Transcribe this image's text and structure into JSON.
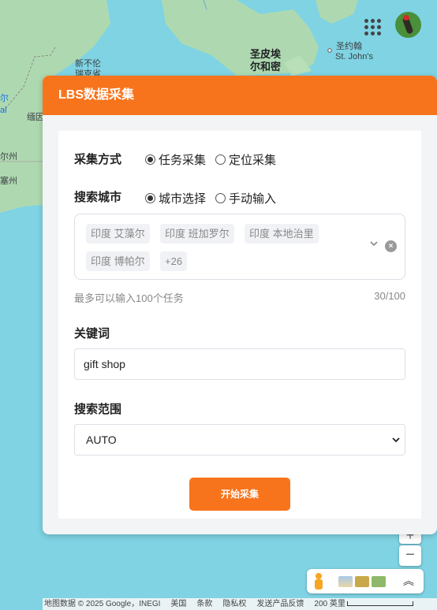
{
  "map": {
    "labels": {
      "saint_pierre": "圣皮埃",
      "miquelon": "尔和密",
      "st_johns_cn": "圣约翰",
      "st_johns_en": "St. John's",
      "newfoundland_1": "新不伦",
      "newfoundland_2": "瑞克省",
      "maine_frag": "缅因",
      "state_frag_1": "尔州",
      "state_frag_2": "塞州",
      "blue_frag_1": "尔",
      "blue_frag_2": "al"
    },
    "attribution": {
      "data": "地图数据 © 2025 Google，INEGI",
      "country": "美国",
      "terms": "条款",
      "privacy": "隐私权",
      "feedback": "发送产品反馈",
      "scale": "200 英里"
    },
    "colors": {
      "water": "#7fd3e3",
      "land": "#aed9b0"
    }
  },
  "panel": {
    "title": "LBS数据采集",
    "method": {
      "label": "采集方式",
      "options": [
        "任务采集",
        "定位采集"
      ],
      "selected": "任务采集"
    },
    "city": {
      "label": "搜索城市",
      "options": [
        "城市选择",
        "手动输入"
      ],
      "selected": "城市选择",
      "tags": [
        "印度 艾藻尔",
        "印度 班加罗尔",
        "印度 本地治里",
        "印度 博帕尔",
        "+26"
      ],
      "hint": "最多可以输入100个任务",
      "count": "30/100"
    },
    "keyword": {
      "label": "关键词",
      "value": "gift shop"
    },
    "range": {
      "label": "搜索范围",
      "value": "AUTO"
    },
    "start_button": "开始采集",
    "accent": "#f7741c"
  }
}
